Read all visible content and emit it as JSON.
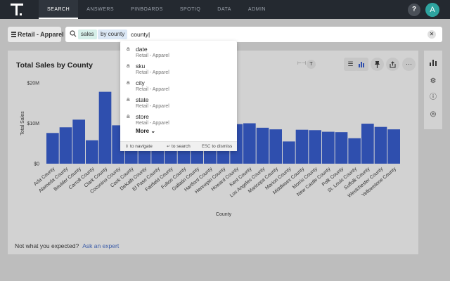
{
  "nav": {
    "items": [
      "SEARCH",
      "ANSWERS",
      "PINBOARDS",
      "SPOTIQ",
      "DATA",
      "ADMIN"
    ],
    "active_index": 0,
    "help_label": "?",
    "avatar_initial": "A"
  },
  "source_button": {
    "label": "Retail - Apparel"
  },
  "search": {
    "tokens": [
      "sales",
      "by county"
    ],
    "query_text": "county"
  },
  "answer": {
    "title": "Total Sales by County",
    "footer_text": "Not what you expected?",
    "footer_link": "Ask an expert"
  },
  "chart_data": {
    "type": "bar",
    "xlabel": "County",
    "ylabel": "Total Sales",
    "ylim": [
      0,
      20
    ],
    "yticks": [
      "$0",
      "$10M",
      "$20M"
    ],
    "categories": [
      "Ada County",
      "Alameda County",
      "Boulder County",
      "Carroll County",
      "Clark County",
      "Coconino County",
      "Cook County",
      "DeKalb County",
      "El Paso County",
      "Fairfield County",
      "Fulton County",
      "Gallatin County",
      "Hartford County",
      "Hennepin County",
      "Howard County",
      "Kent County",
      "Los Angeles County",
      "Maricopa County",
      "Marion County",
      "Middlesex County",
      "Morris County",
      "New Castle County",
      "Polk County",
      "St. Louis County",
      "Suffolk County",
      "Westchester County",
      "Yellowstone County"
    ],
    "values": [
      7.6,
      9,
      10.9,
      5.8,
      17.8,
      9.5,
      8,
      8,
      8,
      8,
      8,
      8,
      8,
      9,
      9.8,
      10,
      8.9,
      8.5,
      5.5,
      8.4,
      8.3,
      7.9,
      7.8,
      6.3,
      9.9,
      9.1,
      8.5
    ],
    "bar_color": "#2f4fae"
  },
  "dropdown": {
    "items": [
      {
        "type": "a",
        "name": "date",
        "source": "Retail - Apparel"
      },
      {
        "type": "a",
        "name": "sku",
        "source": "Retail - Apparel"
      },
      {
        "type": "a",
        "name": "city",
        "source": "Retail - Apparel"
      },
      {
        "type": "a",
        "name": "state",
        "source": "Retail - Apparel"
      },
      {
        "type": "a",
        "name": "store",
        "source": "Retail - Apparel"
      }
    ],
    "more_label": "More",
    "hints": {
      "navigate": "to navigate",
      "search": "to search",
      "dismiss_key": "ESC",
      "dismiss": "to dismiss"
    }
  },
  "toolbar": {
    "menu_label": "···"
  },
  "colors": {
    "accent": "#2f4fae",
    "nav_bg": "#242930",
    "avatar": "#2ea4a0"
  }
}
